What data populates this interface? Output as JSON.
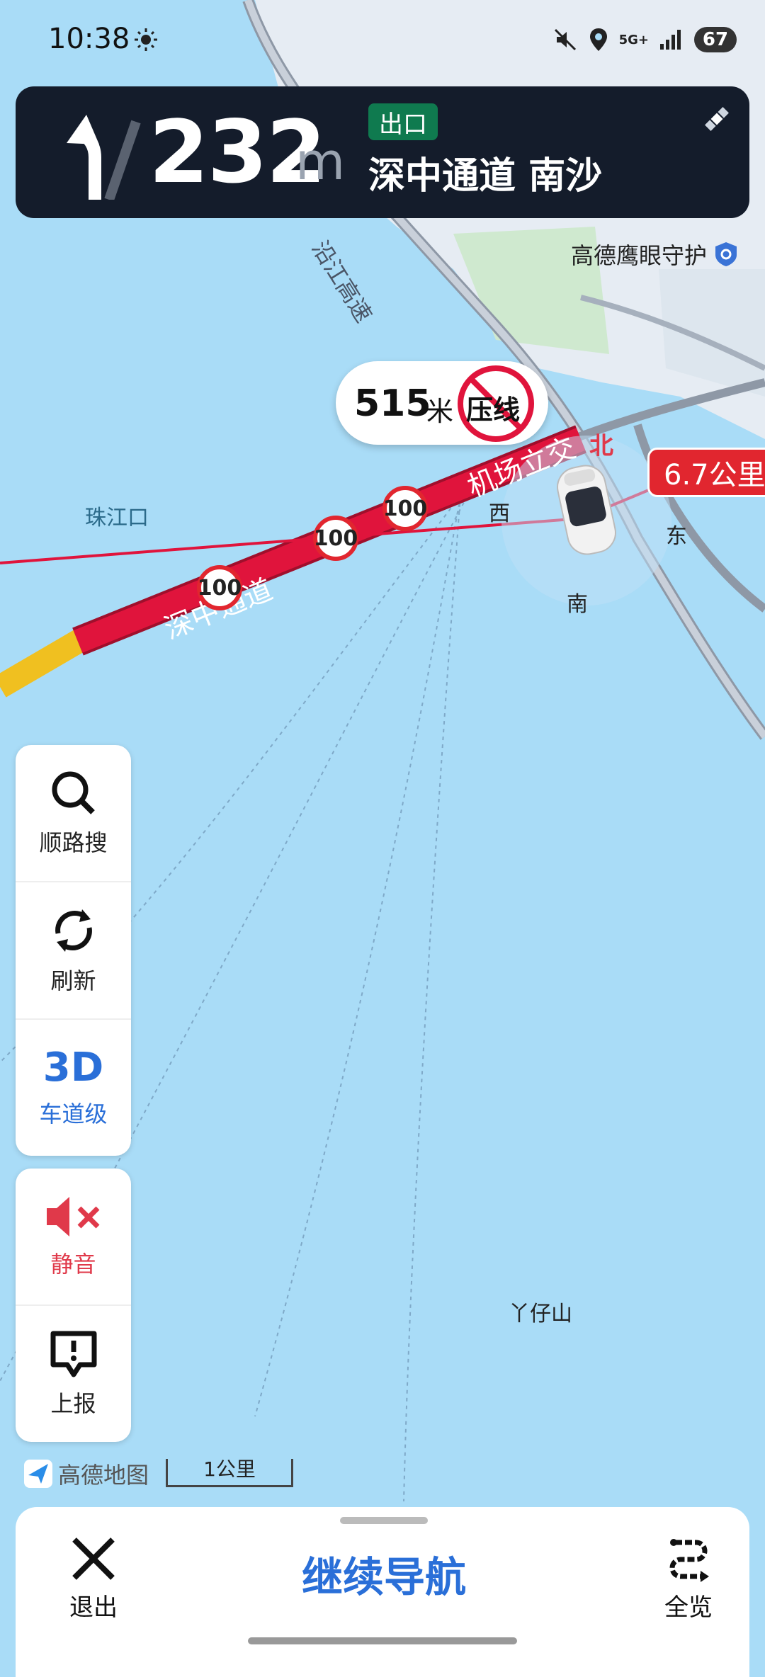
{
  "status_bar": {
    "time": "10:38",
    "battery": "67",
    "network": "5G+"
  },
  "nav_banner": {
    "distance": "232",
    "unit": "m",
    "exit_label": "出口",
    "road_name": "深中通道 南沙"
  },
  "eagle_eye": {
    "label": "高德鹰眼守护"
  },
  "map": {
    "warning_distance": "515",
    "warning_unit": "米",
    "warning_text": "压线",
    "remaining": "6.7公里",
    "road_labels": [
      "机场立交",
      "深中通道",
      "沿江高速"
    ],
    "compass": {
      "north": "北",
      "west": "西",
      "east": "东",
      "south": "南"
    },
    "places": [
      "珠江口",
      "丫仔山"
    ],
    "speed_limits": [
      "100",
      "100",
      "100"
    ]
  },
  "side_panel": {
    "search": "顺路搜",
    "refresh": "刷新",
    "lane_3d": "3D",
    "lane_label": "车道级",
    "mute": "静音",
    "report": "上报"
  },
  "map_footer": {
    "logo": "高德地图",
    "scale": "1公里"
  },
  "bottom_bar": {
    "exit": "退出",
    "continue": "继续导航",
    "overview": "全览"
  },
  "colors": {
    "route": "#d8143c",
    "banner": "#141c2b",
    "accent_blue": "#2a6fd8",
    "exit_green": "#0f7a4f"
  }
}
